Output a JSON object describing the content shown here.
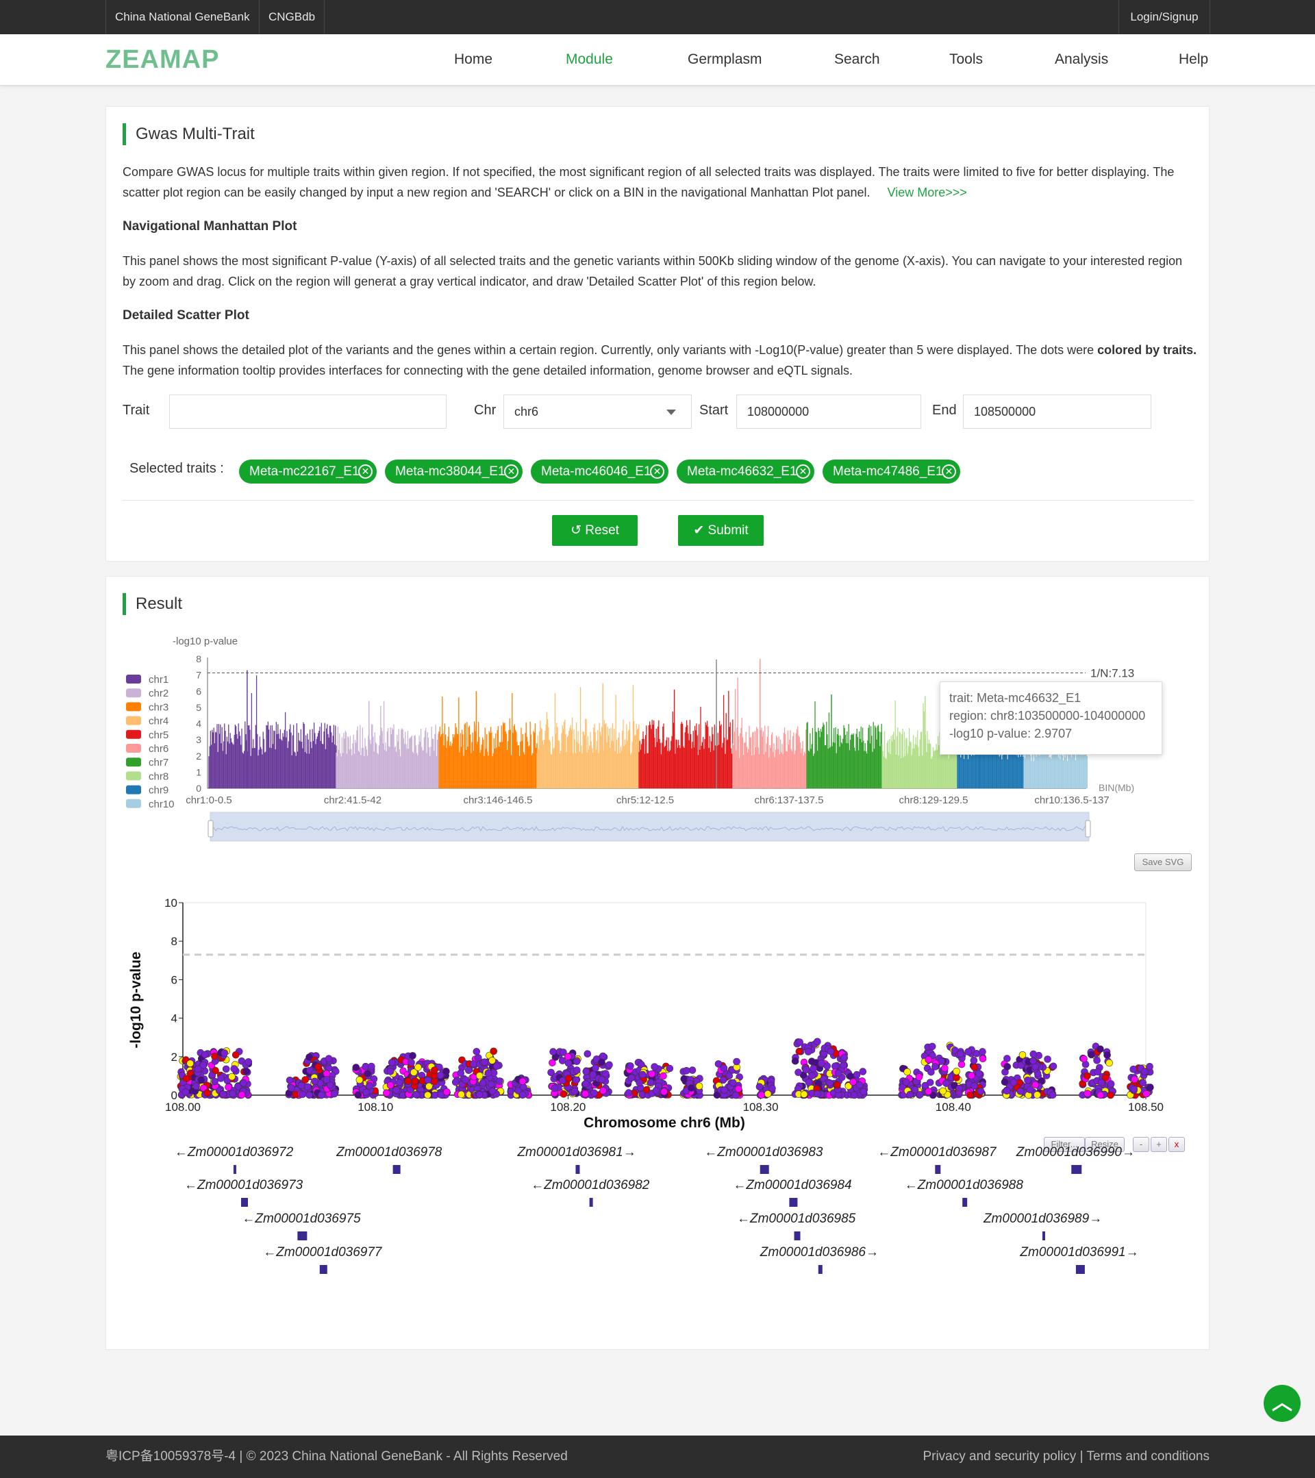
{
  "topbar": {
    "links": [
      "China National GeneBank",
      "CNGBdb"
    ],
    "login": "Login/Signup"
  },
  "nav": {
    "logo": "ZEAMAP",
    "items": [
      "Home",
      "Module",
      "Germplasm",
      "Search",
      "Tools",
      "Analysis",
      "Help"
    ],
    "active": "Module",
    "accent_color": "#1fa23f"
  },
  "intro": {
    "title": "Gwas Multi-Trait",
    "description": "Compare GWAS locus for multiple traits within given region. If not specified, the most significant region of all selected traits was displayed. The traits were limited to five for better displaying. The scatter plot region can be easily changed by input a new region and 'SEARCH' or click on a BIN in the navigational Manhattan Plot panel.",
    "view_more": "View More>>>",
    "nav_heading": "Navigational Manhattan Plot",
    "nav_text": "This panel shows the most significant P-value (Y-axis) of all selected traits and the genetic variants within 500Kb sliding window of the genome (X-axis). You can navigate to your interested region by zoom and drag. Click on the region will generat a gray vertical indicator, and draw 'Detailed Scatter Plot' of this region below.",
    "scatter_heading": "Detailed Scatter Plot",
    "scatter_text_1": "This panel shows the detailed plot of the variants and the genes within a certain region. Currently, only variants with -Log10(P-value) greater than 5 were displayed. The dots were",
    "scatter_text_bold": "colored by traits.",
    "scatter_text_2": "The gene information tooltip provides interfaces for connecting with the gene detailed information, genome browser and eQTL signals."
  },
  "form": {
    "trait_label": "Trait",
    "trait_value": "",
    "chr_label": "Chr",
    "chr_value": "chr6",
    "start_label": "Start",
    "start_value": "108000000",
    "end_label": "End",
    "end_value": "108500000",
    "selected_label": "Selected traits :",
    "selected_traits": [
      "Meta-mc22167_E1",
      "Meta-mc38044_E1",
      "Meta-mc46046_E1",
      "Meta-mc46632_E1",
      "Meta-mc47486_E1"
    ],
    "reset_label": "Reset",
    "submit_label": "Submit"
  },
  "result": {
    "title": "Result",
    "save_svg": "Save SVG",
    "tooltip": {
      "trait": "trait: Meta-mc46632_E1",
      "region": "region: chr8:103500000-104000000",
      "pvalue": "-log10 p-value: 2.9707"
    },
    "controls": [
      "Filter...",
      "Resize",
      "-",
      "+",
      "x"
    ]
  },
  "chart_data": [
    {
      "type": "bar",
      "title": "",
      "ylabel": "-log10 p-value",
      "xlabel": "BIN(Mb)",
      "ylim": [
        0,
        8
      ],
      "yticks": [
        0,
        1,
        2,
        3,
        4,
        5,
        6,
        7,
        8
      ],
      "threshold": 7.13,
      "threshold_label": "1/N:7.13",
      "xtick_labels": [
        "chr1:0-0.5",
        "chr2:41.5-42",
        "chr3:146-146.5",
        "chr5:12-12.5",
        "chr6:137-137.5",
        "chr8:129-129.5",
        "chr10:136.5-137"
      ],
      "legend_position": "left",
      "series": [
        {
          "name": "chr1",
          "color": "#6a3d9a",
          "typical": 3.6,
          "peak": 7.3
        },
        {
          "name": "chr2",
          "color": "#cab2d6",
          "typical": 3.5,
          "peak": 5.4
        },
        {
          "name": "chr3",
          "color": "#ff7f00",
          "typical": 3.6,
          "peak": 6.0
        },
        {
          "name": "chr4",
          "color": "#fdbf6f",
          "typical": 3.8,
          "peak": 6.5
        },
        {
          "name": "chr5",
          "color": "#e31a1c",
          "typical": 3.7,
          "peak": 6.1
        },
        {
          "name": "chr6",
          "color": "#fb9a99",
          "typical": 3.4,
          "peak": 8.0
        },
        {
          "name": "chr7",
          "color": "#33a02c",
          "typical": 3.6,
          "peak": 5.8
        },
        {
          "name": "chr8",
          "color": "#b2df8a",
          "typical": 3.3,
          "peak": 5.7
        },
        {
          "name": "chr9",
          "color": "#1f78b4",
          "typical": 3.2,
          "peak": 5.0
        },
        {
          "name": "chr10",
          "color": "#a6cee3",
          "typical": 3.0,
          "peak": 4.5
        }
      ]
    },
    {
      "type": "scatter",
      "title": "",
      "xlabel": "Chromosome chr6 (Mb)",
      "ylabel": "-log10 p-value",
      "xlim": [
        108.0,
        108.5
      ],
      "ylim": [
        0,
        10
      ],
      "xticks": [
        "108.00",
        "108.10",
        "108.20",
        "108.30",
        "108.40",
        "108.50"
      ],
      "yticks": [
        0,
        2,
        4,
        6,
        8,
        10
      ],
      "threshold": 7.3,
      "trait_colors": [
        "#7b1fd6",
        "#e00000",
        "#ffee00",
        "#ff00ff",
        "#4b0c8a"
      ],
      "clusters": [
        {
          "x": 108.005,
          "max": 1.9
        },
        {
          "x": 108.013,
          "max": 2.3
        },
        {
          "x": 108.027,
          "max": 2.4
        },
        {
          "x": 108.058,
          "max": 0.8
        },
        {
          "x": 108.068,
          "max": 2.1
        },
        {
          "x": 108.074,
          "max": 1.9
        },
        {
          "x": 108.095,
          "max": 1.5
        },
        {
          "x": 108.112,
          "max": 2.0
        },
        {
          "x": 108.123,
          "max": 2.1
        },
        {
          "x": 108.132,
          "max": 1.5
        },
        {
          "x": 108.148,
          "max": 2.0
        },
        {
          "x": 108.158,
          "max": 2.3
        },
        {
          "x": 108.173,
          "max": 0.6
        },
        {
          "x": 108.176,
          "max": 0.9
        },
        {
          "x": 108.198,
          "max": 2.3
        },
        {
          "x": 108.215,
          "max": 2.2
        },
        {
          "x": 108.236,
          "max": 1.7
        },
        {
          "x": 108.248,
          "max": 1.5
        },
        {
          "x": 108.264,
          "max": 1.3
        },
        {
          "x": 108.283,
          "max": 1.9
        },
        {
          "x": 108.303,
          "max": 0.9
        },
        {
          "x": 108.326,
          "max": 2.8
        },
        {
          "x": 108.337,
          "max": 2.6
        },
        {
          "x": 108.35,
          "max": 1.3
        },
        {
          "x": 108.378,
          "max": 1.4
        },
        {
          "x": 108.393,
          "max": 2.6
        },
        {
          "x": 108.408,
          "max": 2.4
        },
        {
          "x": 108.433,
          "max": 2.1
        },
        {
          "x": 108.445,
          "max": 2.3
        },
        {
          "x": 108.475,
          "max": 2.6
        },
        {
          "x": 108.497,
          "max": 1.6
        }
      ]
    }
  ],
  "genes": [
    {
      "name": "←Zm00001d036972",
      "x": 108.027
    },
    {
      "name": "Zm00001d036978",
      "x": 108.111
    },
    {
      "name": "Zm00001d036981→",
      "x": 108.205
    },
    {
      "name": "←Zm00001d036983",
      "x": 108.302
    },
    {
      "name": "←Zm00001d036987",
      "x": 108.392
    },
    {
      "name": "Zm00001d036990→",
      "x": 108.464
    },
    {
      "name": "←Zm00001d036973",
      "x": 108.032
    },
    {
      "name": "←Zm00001d036982",
      "x": 108.212
    },
    {
      "name": "←Zm00001d036984",
      "x": 108.317
    },
    {
      "name": "←Zm00001d036988",
      "x": 108.406
    },
    {
      "name": "←Zm00001d036975",
      "x": 108.062
    },
    {
      "name": "←Zm00001d036985",
      "x": 108.319
    },
    {
      "name": "Zm00001d036989→",
      "x": 108.447
    },
    {
      "name": "←Zm00001d036977",
      "x": 108.073
    },
    {
      "name": "Zm00001d036986→",
      "x": 108.331
    },
    {
      "name": "Zm00001d036991→",
      "x": 108.466
    }
  ],
  "footer": {
    "left": "粤ICP备10059378号-4 | © 2023 China National GeneBank - All Rights Reserved",
    "right": "Privacy and security policy | Terms and conditions"
  }
}
